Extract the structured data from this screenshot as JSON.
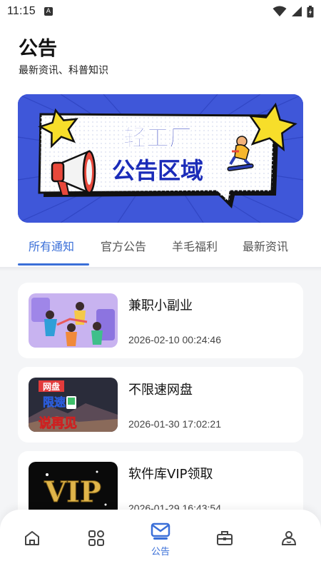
{
  "status_bar": {
    "time": "11:15",
    "notification_icon": "A"
  },
  "header": {
    "title": "公告",
    "subtitle": "最新资讯、科普知识"
  },
  "banner": {
    "line1": "轻工厂",
    "line2": "公告区域"
  },
  "tabs": [
    {
      "label": "所有通知",
      "active": true
    },
    {
      "label": "官方公告",
      "active": false
    },
    {
      "label": "羊毛福利",
      "active": false
    },
    {
      "label": "最新资讯",
      "active": false
    }
  ],
  "articles": [
    {
      "title": "兼职小副业",
      "date": "2026-02-10 00:24:46",
      "thumb": "people-illustration"
    },
    {
      "title": "不限速网盘",
      "date": "2026-01-30 17:02:21",
      "thumb_text": [
        "网盘",
        "限速",
        "说再见"
      ]
    },
    {
      "title": "软件库VIP领取",
      "date": "2026-01-29 16:43:54",
      "thumb_text": [
        "VIP"
      ]
    }
  ],
  "bottom_nav": [
    {
      "icon": "home-icon",
      "label": ""
    },
    {
      "icon": "apps-grid-icon",
      "label": ""
    },
    {
      "icon": "mail-icon",
      "label": "公告",
      "active": true
    },
    {
      "icon": "toolbox-icon",
      "label": ""
    },
    {
      "icon": "profile-icon",
      "label": ""
    }
  ],
  "colors": {
    "accent": "#3a6fd8",
    "banner_blue": "#3f57d9",
    "banner_text": "#1a2bb8",
    "star_yellow": "#f7de2a"
  }
}
